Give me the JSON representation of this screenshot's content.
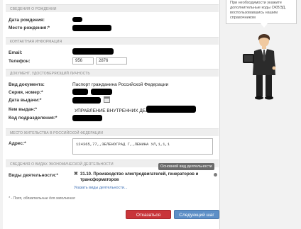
{
  "sections": {
    "birth": "СВЕДЕНИЯ О РОЖДЕНИИ",
    "contact": "КОНТАКТНАЯ ИНФОРМАЦИЯ",
    "document": "ДОКУМЕНТ, УДОСТОВЕРЯЮЩИЙ ЛИЧНОСТЬ",
    "residence": "МЕСТО ЖИТЕЛЬСТВА В РОССИЙСКОЙ ФЕДЕРАЦИИ",
    "activity": "СВЕДЕНИЯ О ВИДАХ ЭКОНОМИЧЕСКОЙ ДЕЯТЕЛЬНОСТИ"
  },
  "birth": {
    "date_label": "Дата рождения:",
    "place_label": "Место рождения:*"
  },
  "contact": {
    "email_label": "Email:",
    "phone_label": "Телефон:",
    "phone_code": "956",
    "phone_number": "2876"
  },
  "document": {
    "type_label": "Вид документа:",
    "type_value": "Паспорт гражданина Российской Федерации",
    "series_label": "Серия, номер:*",
    "issue_date_label": "Дата выдачи:*",
    "issued_by_label": "Кем выдан:*",
    "issued_by_value": "УПРАВЛЕНИЕ ВНУТРЕННИХ ДЕЛ П",
    "division_code_label": "Код подразделения:*"
  },
  "residence": {
    "address_label": "Адрес:*",
    "address_value": "124365,77,,ЗЕЛЕНОГРАД Г,,ЛЕНИНА УЛ,1,1,1"
  },
  "activity": {
    "tooltip": "Основной вид деятельности",
    "label": "Виды деятельности:*",
    "item_code": "31.10.",
    "item_text_line1": "Производство электродвигателей, генераторов и",
    "item_text_line2": "трансформаторов",
    "show_link": "Указать виды деятельности..."
  },
  "footer": {
    "required_note": "* - Поля, обязательные для заполнения",
    "refuse_button": "Отказаться",
    "next_button": "Следующий шаг"
  },
  "helper": {
    "line1": "При необходимости укажите",
    "line2": "дополнительные коды ОКВЭД,",
    "line3": "воспользовавшись нашим",
    "line4": "справочником"
  },
  "colors": {
    "refuse": "#c9353a",
    "next": "#5d8fc7",
    "link": "#3d6fb5"
  }
}
